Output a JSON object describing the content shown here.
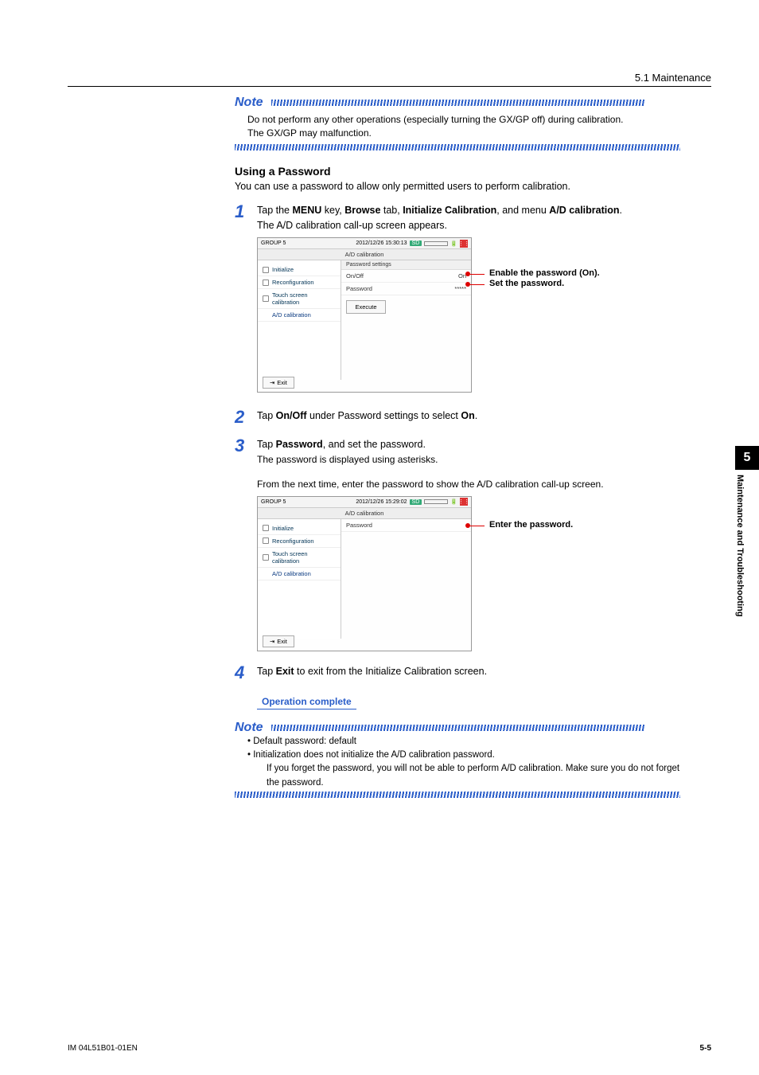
{
  "header": {
    "section": "5.1  Maintenance"
  },
  "note1": {
    "title": "Note",
    "line1": "Do not perform any other operations (especially turning the GX/GP off) during calibration.",
    "line2": "The GX/GP may malfunction."
  },
  "section": {
    "heading": "Using a Password",
    "lead": "You can use a password to allow only permitted users to perform calibration."
  },
  "step1": {
    "num": "1",
    "text_a": "Tap the ",
    "b1": "MENU",
    "t2": " key, ",
    "b2": "Browse",
    "t3": " tab, ",
    "b3": "Initialize Calibration",
    "t4": ", and menu ",
    "b4": "A/D calibration",
    "t5": ".",
    "sub": "The A/D calibration call-up screen appears."
  },
  "ss1": {
    "timestamp": "2012/12/26 15:30:13",
    "sd": "SD",
    "breadcrumb": "A/D calibration",
    "side": {
      "i1": "Initialize",
      "i2": "Reconfiguration",
      "i3": "Touch screen calibration",
      "i4": "A/D calibration"
    },
    "group": "Password settings",
    "f1_label": "On/Off",
    "f1_val": "On",
    "f2_label": "Password",
    "f2_val": "*****",
    "execute": "Execute",
    "exit": "Exit"
  },
  "callout1": "Enable the password (On).",
  "callout2": "Set the password.",
  "step2": {
    "num": "2",
    "t1": "Tap ",
    "b1": "On/Off",
    "t2": " under Password settings to select ",
    "b2": "On",
    "t3": "."
  },
  "step3": {
    "num": "3",
    "t1": "Tap ",
    "b1": "Password",
    "t2": ", and set the password.",
    "sub": "The password is displayed using asterisks."
  },
  "between": "From the next time, enter the password to show the A/D calibration call-up screen.",
  "ss2": {
    "timestamp": "2012/12/26 15:29:02",
    "breadcrumb": "A/D calibration",
    "f1_label": "Password"
  },
  "callout3": "Enter the password.",
  "step4": {
    "num": "4",
    "t1": "Tap ",
    "b1": "Exit",
    "t2": " to exit from the Initialize Calibration screen."
  },
  "op_complete": "Operation complete",
  "note2": {
    "title": "Note",
    "li1": "Default password: default",
    "li2": "Initialization does not initialize the A/D calibration password.",
    "li2b": "If you forget the password, you will not be able to perform A/D calibration. Make sure you do not forget the password."
  },
  "sidetab": {
    "num": "5",
    "label": "Maintenance and Troubleshooting"
  },
  "footer": {
    "left": "IM 04L51B01-01EN",
    "right": "5-5"
  }
}
